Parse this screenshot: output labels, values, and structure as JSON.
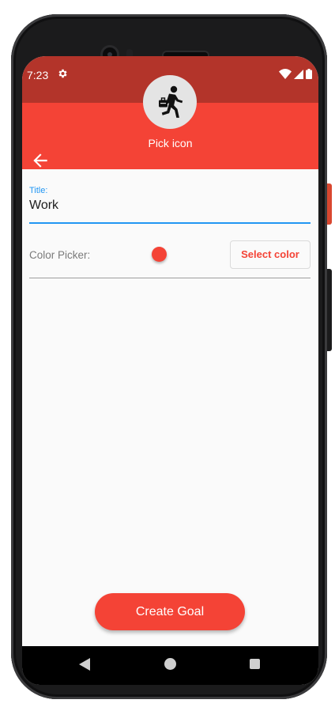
{
  "status": {
    "time": "7:23",
    "icons": [
      "gear-icon",
      "wifi-icon",
      "cell-signal-icon",
      "battery-icon"
    ]
  },
  "appbar": {
    "pick_icon_label": "Pick icon",
    "selected_icon": "running-businessman-icon",
    "background": "#f44336"
  },
  "form": {
    "title_label": "Title:",
    "title_value": "Work",
    "color_picker_label": "Color Picker:",
    "selected_color": "#f44336",
    "select_color_button": "Select color"
  },
  "actions": {
    "create_goal_button": "Create Goal"
  },
  "colors": {
    "accent": "#f44336",
    "status_bar": "#b3342a",
    "focus": "#2196f3"
  }
}
